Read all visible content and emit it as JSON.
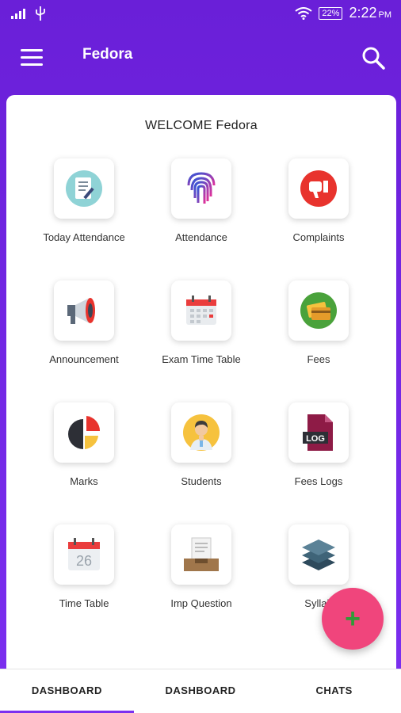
{
  "status_bar": {
    "battery": "22%",
    "time": "2:22",
    "ampm": "PM"
  },
  "app_bar": {
    "title": "Fedora",
    "menu_icon": "hamburger-menu-icon",
    "search_icon": "search-icon"
  },
  "welcome": "WELCOME Fedora",
  "tiles": [
    {
      "label": "Today Attendance",
      "icon": "notepad-icon"
    },
    {
      "label": "Attendance",
      "icon": "fingerprint-icon"
    },
    {
      "label": "Complaints",
      "icon": "thumbs-down-icon"
    },
    {
      "label": "Announcement",
      "icon": "megaphone-icon"
    },
    {
      "label": "Exam Time Table",
      "icon": "calendar-icon"
    },
    {
      "label": "Fees",
      "icon": "payment-card-icon"
    },
    {
      "label": "Marks",
      "icon": "pie-chart-icon"
    },
    {
      "label": "Students",
      "icon": "student-avatar-icon"
    },
    {
      "label": "Fees Logs",
      "icon": "log-file-icon"
    },
    {
      "label": "Time Table",
      "icon": "calendar-day-icon"
    },
    {
      "label": "Imp Question",
      "icon": "document-tray-icon"
    },
    {
      "label": "Syllab",
      "icon": "layers-icon"
    }
  ],
  "calendar_day": "26",
  "log_text": "LOG",
  "fab_label": "+",
  "bottom_nav": [
    {
      "label": "DASHBOARD",
      "active": true
    },
    {
      "label": "DASHBOARD",
      "active": false
    },
    {
      "label": "CHATS",
      "active": false
    }
  ],
  "colors": {
    "primary": "#7b2ff0",
    "fab": "#f0457c",
    "fab_plus": "#2f9b37"
  }
}
